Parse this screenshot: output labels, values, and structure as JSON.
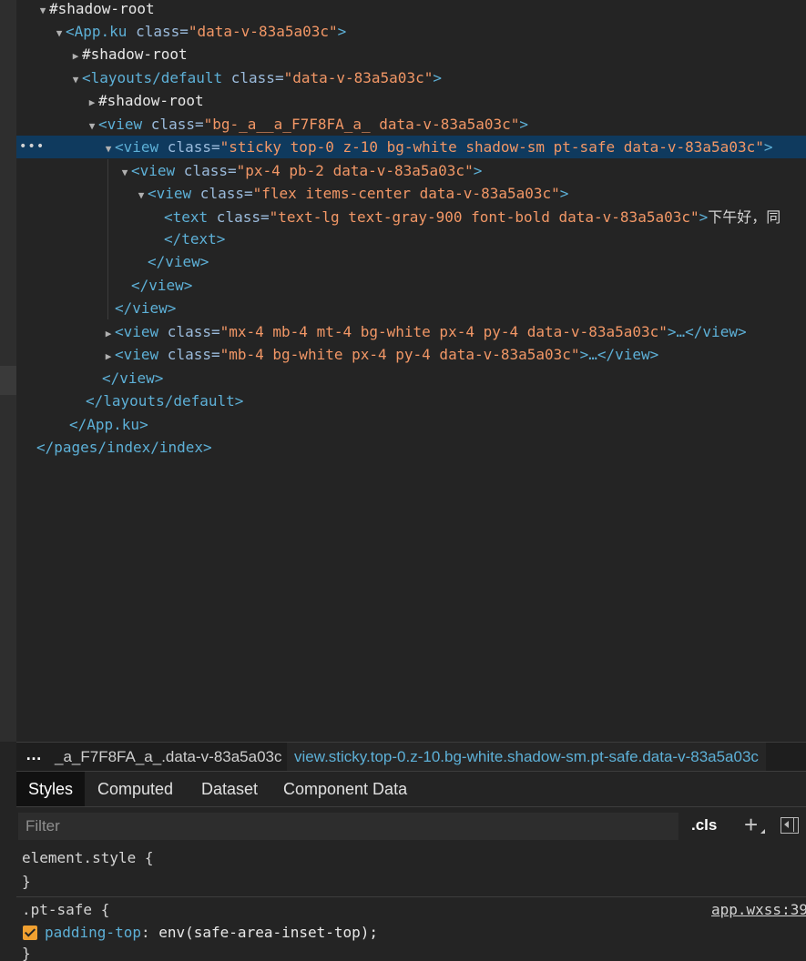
{
  "tree": {
    "lines": [
      {
        "pre": "",
        "tag_open": "",
        "attr": "",
        "val": "",
        "tag_close": "",
        "text": "#shadow-root"
      },
      {
        "pre": "<",
        "tag_open": "App.ku",
        "attr": " class=",
        "val": "\"data-v-83a5a03c\"",
        "tag_close": ">",
        "text": ""
      },
      {
        "pre": "",
        "tag_open": "",
        "attr": "",
        "val": "",
        "tag_close": "",
        "text": "#shadow-root"
      },
      {
        "pre": "<",
        "tag_open": "layouts/default",
        "attr": " class=",
        "val": "\"data-v-83a5a03c\"",
        "tag_close": ">",
        "text": ""
      },
      {
        "pre": "",
        "tag_open": "",
        "attr": "",
        "val": "",
        "tag_close": "",
        "text": "#shadow-root"
      },
      {
        "pre": "<",
        "tag_open": "view",
        "attr": " class=",
        "val": "\"bg-_a__a_F7F8FA_a_ data-v-83a5a03c\"",
        "tag_close": ">",
        "text": ""
      },
      {
        "pre": "<",
        "tag_open": "view",
        "attr": " class=",
        "val": "\"sticky top-0 z-10 bg-white shadow-sm pt-safe data-v-83a5a03c\"",
        "tag_close": ">",
        "text": ""
      },
      {
        "pre": "<",
        "tag_open": "view",
        "attr": " class=",
        "val": "\"px-4 pb-2 data-v-83a5a03c\"",
        "tag_close": ">",
        "text": ""
      },
      {
        "pre": "<",
        "tag_open": "view",
        "attr": " class=",
        "val": "\"flex items-center data-v-83a5a03c\"",
        "tag_close": ">",
        "text": ""
      },
      {
        "pre": "<",
        "tag_open": "text",
        "attr": " class=",
        "val": "\"text-lg text-gray-900 font-bold data-v-83a5a03c\"",
        "tag_close": ">",
        "text": "下午好，同"
      },
      {
        "pre": "</",
        "tag_open": "text",
        "attr": "",
        "val": "",
        "tag_close": ">",
        "text": ""
      },
      {
        "pre": "</",
        "tag_open": "view",
        "attr": "",
        "val": "",
        "tag_close": ">",
        "text": ""
      },
      {
        "pre": "</",
        "tag_open": "view",
        "attr": "",
        "val": "",
        "tag_close": ">",
        "text": ""
      },
      {
        "pre": "</",
        "tag_open": "view",
        "attr": "",
        "val": "",
        "tag_close": ">",
        "text": ""
      },
      {
        "pre": "<",
        "tag_open": "view",
        "attr": " class=",
        "val": "\"mx-4 mb-4 mt-4 bg-white px-4 py-4 data-v-83a5a03c\"",
        "tag_close": ">…</view>",
        "text": ""
      },
      {
        "pre": "<",
        "tag_open": "view",
        "attr": " class=",
        "val": "\"mb-4 bg-white px-4 py-4 data-v-83a5a03c\"",
        "tag_close": ">…</view>",
        "text": ""
      },
      {
        "pre": "</",
        "tag_open": "view",
        "attr": "",
        "val": "",
        "tag_close": ">",
        "text": ""
      },
      {
        "pre": "</",
        "tag_open": "layouts/default",
        "attr": "",
        "val": "",
        "tag_close": ">",
        "text": ""
      },
      {
        "pre": "</",
        "tag_open": "App.ku",
        "attr": "",
        "val": "",
        "tag_close": ">",
        "text": ""
      },
      {
        "pre": "</",
        "tag_open": "pages/index/index",
        "attr": "",
        "val": "",
        "tag_close": ">",
        "text": ""
      }
    ],
    "selected_more": "•••"
  },
  "breadcrumb": {
    "more": "…",
    "items": [
      "_a_F7F8FA_a_.data-v-83a5a03c",
      "view.sticky.top-0.z-10.bg-white.shadow-sm.pt-safe.data-v-83a5a03c"
    ]
  },
  "tabs": [
    {
      "label": "Styles",
      "active": true
    },
    {
      "label": "Computed",
      "active": false
    },
    {
      "label": "Dataset",
      "active": false
    },
    {
      "label": "Component Data",
      "active": false
    }
  ],
  "filter": {
    "placeholder": "Filter",
    "value": "",
    "cls_label": ".cls",
    "plus_label": "+"
  },
  "styles": {
    "rule1_selector": "element.style {",
    "rule1_close": "}",
    "rule2_selector": ".pt-safe {",
    "rule2_source": "app.wxss:39",
    "rule2_prop_name": "padding-top",
    "rule2_colon": ": ",
    "rule2_prop_value": "env(safe-area-inset-top);",
    "rule2_close": "}"
  },
  "colors": {
    "background": "#242424",
    "selection": "#0f3a5e",
    "tag": "#5db0d7",
    "attr_value": "#f29766",
    "checkbox": "#f0a030"
  }
}
